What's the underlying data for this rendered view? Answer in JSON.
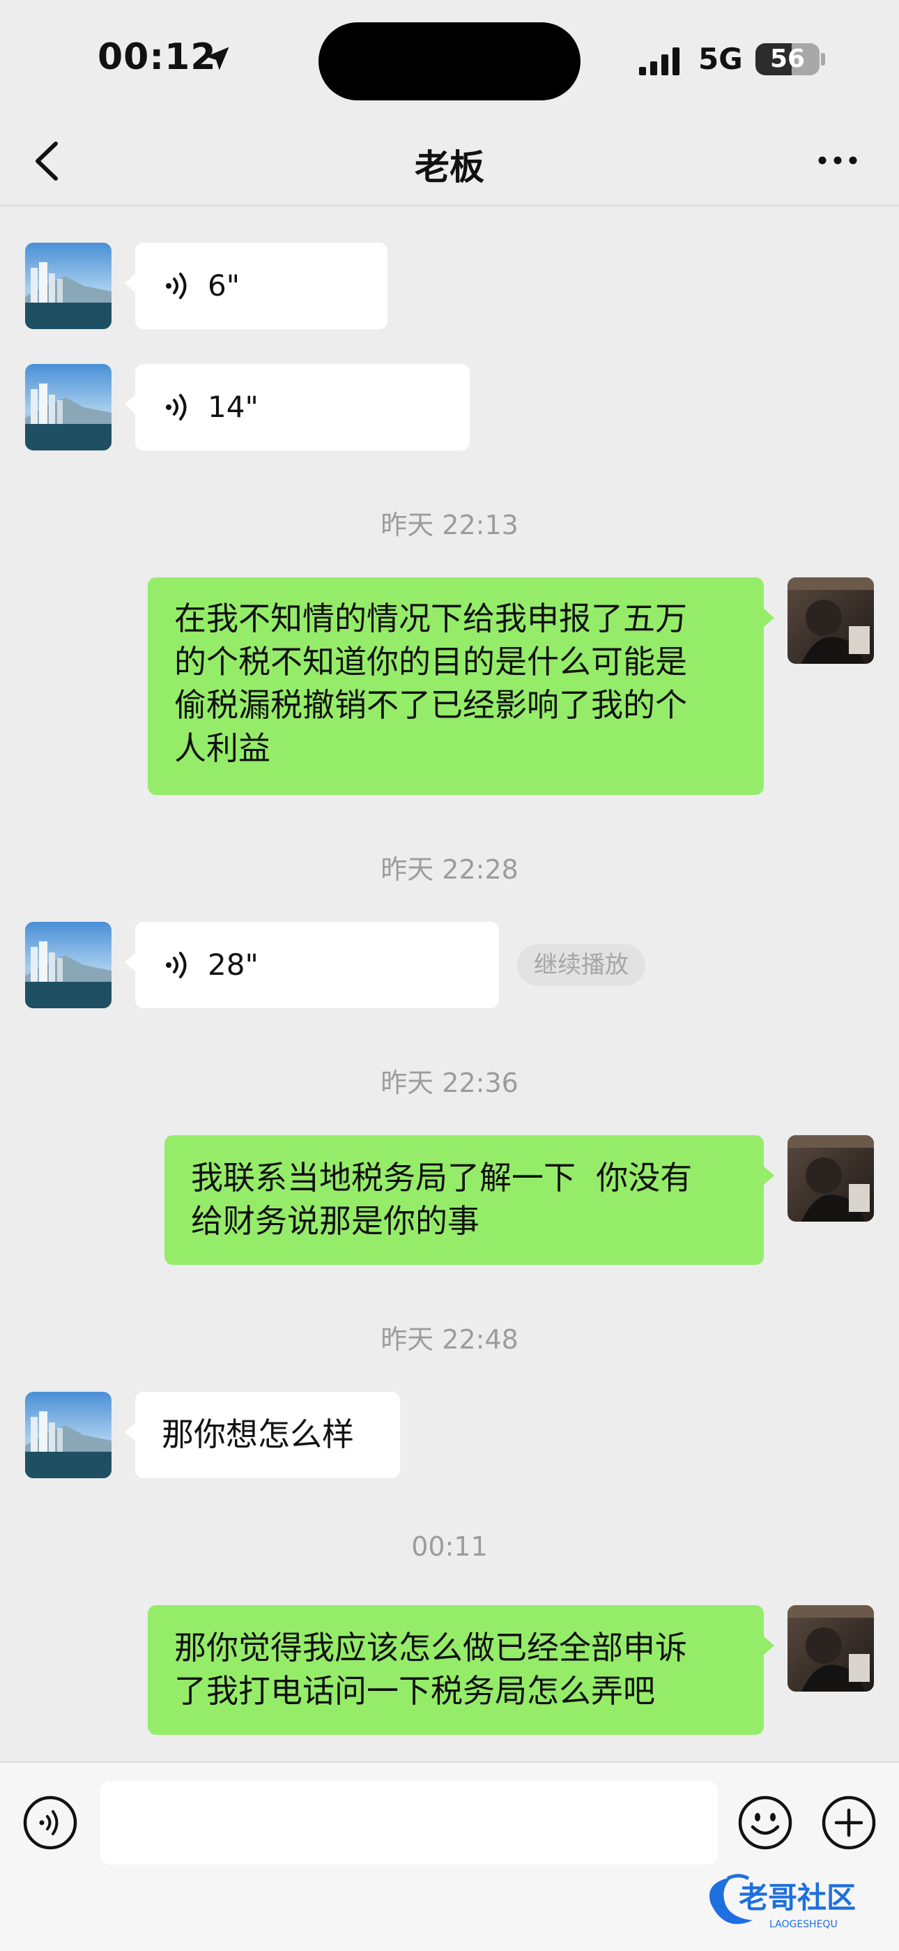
{
  "status_bar": {
    "time": "00:12",
    "network": "5G",
    "battery": "56"
  },
  "header": {
    "title": "老板"
  },
  "messages": [
    {
      "kind": "voice",
      "from": "boss",
      "duration": "6\""
    },
    {
      "kind": "voice",
      "from": "boss",
      "duration": "14\""
    },
    {
      "kind": "timestamp",
      "text": "昨天 22:13"
    },
    {
      "kind": "text",
      "from": "me",
      "lines": [
        "在我不知情的情况下给我申报了五万",
        "的个税不知道你的目的是什么可能是",
        "偷税漏税撤销不了已经影响了我的个",
        "人利益"
      ]
    },
    {
      "kind": "timestamp",
      "text": "昨天 22:28"
    },
    {
      "kind": "voice",
      "from": "boss",
      "duration": "28\"",
      "action": "继续播放"
    },
    {
      "kind": "timestamp",
      "text": "昨天 22:36"
    },
    {
      "kind": "text",
      "from": "me",
      "lines": [
        "我联系当地税务局了解一下  你没有",
        "给财务说那是你的事"
      ]
    },
    {
      "kind": "timestamp",
      "text": "昨天 22:48"
    },
    {
      "kind": "text",
      "from": "boss",
      "lines": [
        "那你想怎么样"
      ]
    },
    {
      "kind": "timestamp",
      "text": "00:11"
    },
    {
      "kind": "text",
      "from": "me",
      "lines": [
        "那你觉得我应该怎么做已经全部申诉",
        "了我打电话问一下税务局怎么弄吧"
      ]
    }
  ],
  "input_bar": {
    "value": ""
  },
  "watermark": {
    "text": "老哥社区",
    "subtext": "LAOGESHEQU"
  },
  "colors": {
    "background": "#ededed",
    "outgoing_bubble": "#95ec69",
    "incoming_bubble": "#ffffff",
    "timestamp": "#9c9c9c"
  },
  "icons": [
    "location-arrow-icon",
    "signal-bars-icon",
    "back-chevron-icon",
    "more-dots-icon",
    "voice-wave-icon",
    "voice-input-icon",
    "emoji-icon",
    "plus-icon"
  ]
}
